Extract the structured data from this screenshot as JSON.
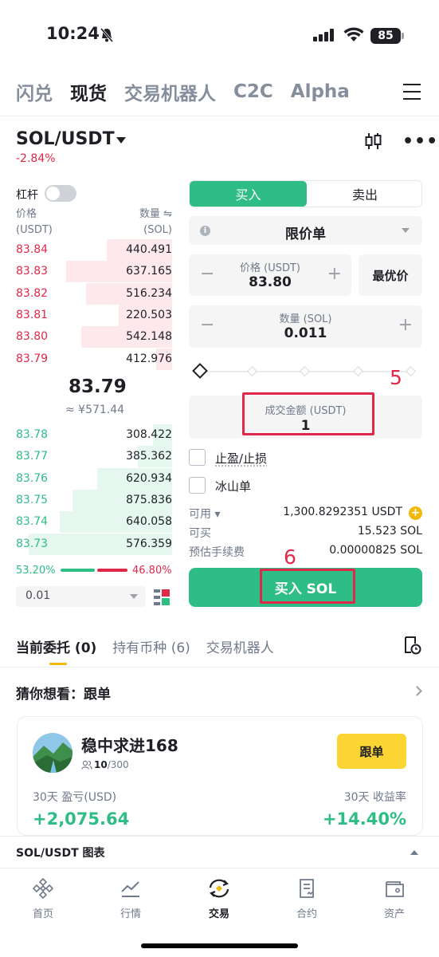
{
  "status_bar": {
    "time": "10:24",
    "battery": "85"
  },
  "top_nav": {
    "items": [
      "闪兑",
      "现货",
      "交易机器人",
      "C2C",
      "Alpha"
    ],
    "active": "现货"
  },
  "pair": {
    "symbol": "SOL/USDT",
    "change": "-2.84%"
  },
  "orderbook": {
    "leverage_label": "杠杆",
    "price_header": "价格",
    "price_unit": "(USDT)",
    "qty_header": "数量 ⇋",
    "qty_unit": "(SOL)",
    "asks": [
      {
        "price": "83.84",
        "qty": "440.491",
        "depth": 0.42
      },
      {
        "price": "83.83",
        "qty": "637.165",
        "depth": 0.68
      },
      {
        "price": "83.82",
        "qty": "516.234",
        "depth": 0.55
      },
      {
        "price": "83.81",
        "qty": "220.503",
        "depth": 0.34
      },
      {
        "price": "83.80",
        "qty": "542.148",
        "depth": 0.58
      },
      {
        "price": "83.79",
        "qty": "412.976",
        "depth": 0.1
      }
    ],
    "mid_price": "83.79",
    "mid_cny": "≈ ¥571.44",
    "bids": [
      {
        "price": "83.78",
        "qty": "308.422",
        "depth": 0.12
      },
      {
        "price": "83.77",
        "qty": "385.362",
        "depth": 0.22
      },
      {
        "price": "83.76",
        "qty": "620.934",
        "depth": 0.48
      },
      {
        "price": "83.75",
        "qty": "875.836",
        "depth": 0.64
      },
      {
        "price": "83.74",
        "qty": "640.058",
        "depth": 0.72
      },
      {
        "price": "83.73",
        "qty": "576.359",
        "depth": 0.92
      }
    ],
    "buy_ratio": "53.20%",
    "sell_ratio": "46.80%",
    "depth_precision": "0.01"
  },
  "trade": {
    "buy_tab": "买入",
    "sell_tab": "卖出",
    "order_type": "限价单",
    "price_label": "价格 (USDT)",
    "price_value": "83.80",
    "best_price": "最优价",
    "qty_label": "数量 (SOL)",
    "qty_value": "0.011",
    "amount_label": "成交金额 (USDT)",
    "amount_value": "1",
    "tp_sl": "止盈/止损",
    "iceberg": "冰山单",
    "available_label": "可用 ▾",
    "available_value": "1,300.8292351 USDT",
    "can_buy_label": "可买",
    "can_buy_value": "15.523 SOL",
    "fee_label": "预估手续费",
    "fee_value": "0.00000825 SOL",
    "buy_button": "买入 SOL",
    "annotation_5": "5",
    "annotation_6": "6"
  },
  "orders": {
    "tabs": [
      "当前委托 (0)",
      "持有币种 (6)",
      "交易机器人"
    ]
  },
  "recommend": {
    "title": "猜你想看：跟单",
    "trader_name": "稳中求进168",
    "followers": "10",
    "followers_max": "/300",
    "follow_button": "跟单",
    "pnl_label": "30天 盈亏(USD)",
    "pnl_value": "+2,075.64",
    "roi_label": "30天 收益率",
    "roi_value": "+14.40%"
  },
  "chart_bar": {
    "label": "SOL/USDT 图表"
  },
  "bottom_nav": {
    "items": [
      "首页",
      "行情",
      "交易",
      "合约",
      "资产"
    ],
    "active": "交易"
  },
  "colors": {
    "green": "#2ebd85",
    "red": "#e0294a",
    "yellow": "#fcd535"
  }
}
